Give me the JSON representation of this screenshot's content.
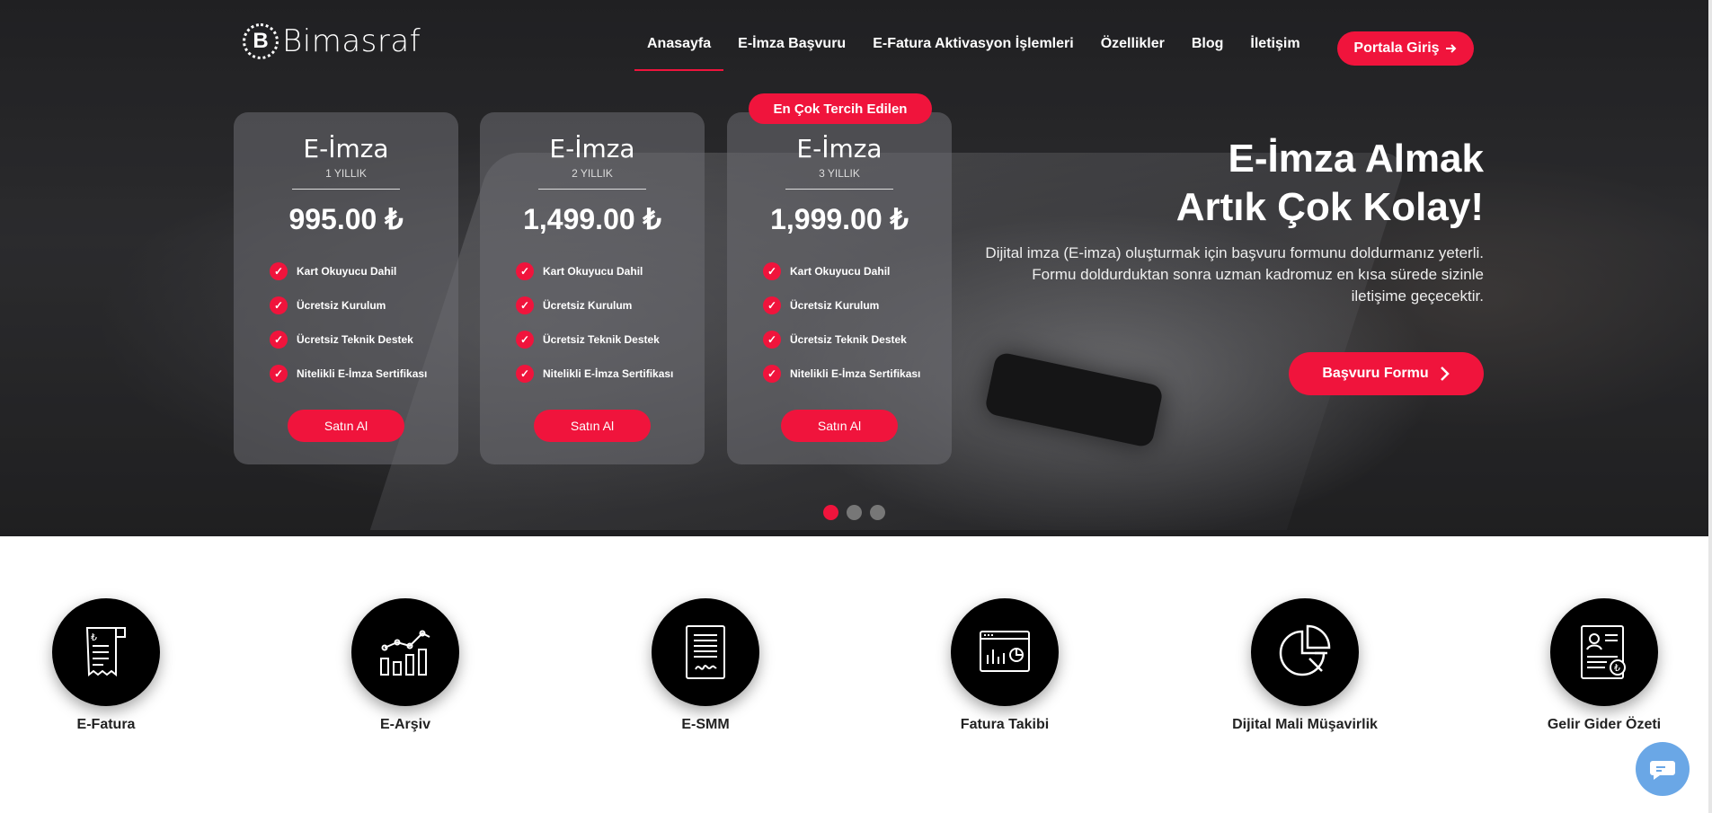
{
  "brand": {
    "name": "Bimasraf",
    "mark": "B",
    "accent": "#f0143c"
  },
  "nav": {
    "items": [
      {
        "label": "Anasayfa"
      },
      {
        "label": "E-İmza Başvuru"
      },
      {
        "label": "E-Fatura Aktivasyon İşlemleri"
      },
      {
        "label": "Özellikler"
      },
      {
        "label": "Blog"
      },
      {
        "label": "İletişim"
      }
    ],
    "portal": {
      "label": "Portala Giriş",
      "icon": "arrow-right-icon"
    }
  },
  "pricing": {
    "ribbon": "En Çok Tercih Edilen",
    "cards": [
      {
        "title": "E-İmza",
        "period": "1 YILLIK",
        "price": "995.00 ₺",
        "buy": "Satın Al",
        "features": [
          "Kart Okuyucu Dahil",
          "Ücretsiz Kurulum",
          "Ücretsiz Teknik Destek",
          "Nitelikli E-İmza Sertifikası"
        ]
      },
      {
        "title": "E-İmza",
        "period": "2 YILLIK",
        "price": "1,499.00 ₺",
        "buy": "Satın Al",
        "features": [
          "Kart Okuyucu Dahil",
          "Ücretsiz Kurulum",
          "Ücretsiz Teknik Destek",
          "Nitelikli E-İmza Sertifikası"
        ]
      },
      {
        "title": "E-İmza",
        "period": "3 YILLIK",
        "price": "1,999.00 ₺",
        "buy": "Satın Al",
        "features": [
          "Kart Okuyucu Dahil",
          "Ücretsiz Kurulum",
          "Ücretsiz Teknik Destek",
          "Nitelikli E-İmza Sertifikası"
        ]
      }
    ]
  },
  "hero": {
    "headline_line1": "E-İmza Almak",
    "headline_line2": "Artık Çok Kolay!",
    "lead": "Dijital imza (E-imza) oluşturmak için başvuru formunu doldurmanız yeterli. Formu doldurduktan sonra uzman kadromuz en kısa sürede sizinle iletişime geçecektir.",
    "cta": "Başvuru Formu",
    "slides_total": 3,
    "slide_active": 1
  },
  "services": [
    {
      "label": "E-Fatura",
      "icon": "invoice-icon"
    },
    {
      "label": "E-Arşiv",
      "icon": "bar-chart-icon"
    },
    {
      "label": "E-SMM",
      "icon": "document-signature-icon"
    },
    {
      "label": "Fatura Takibi",
      "icon": "dashboard-icon"
    },
    {
      "label": "Dijital Mali Müşavirlik",
      "icon": "pie-chart-icon"
    },
    {
      "label": "Gelir Gider Özeti",
      "icon": "profile-document-icon"
    }
  ],
  "chat": {
    "icon": "chat-bubble-icon"
  }
}
